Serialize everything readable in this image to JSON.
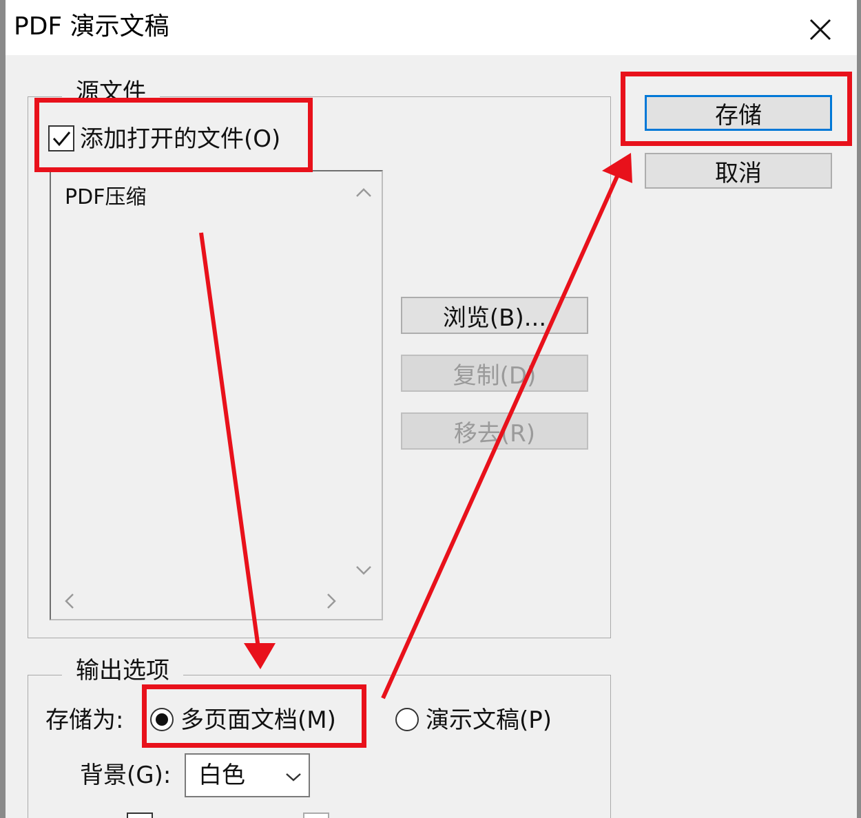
{
  "window": {
    "title": "PDF 演示文稿"
  },
  "source_files": {
    "legend": "源文件",
    "add_open_files_label": "添加打开的文件(O)",
    "add_open_files_checked": true,
    "list_items": [
      "PDF压缩"
    ]
  },
  "file_buttons": {
    "browse": "浏览(B)...",
    "duplicate": "复制(D)",
    "remove": "移去(R)"
  },
  "dialog_buttons": {
    "save": "存储",
    "cancel": "取消"
  },
  "output_options": {
    "legend": "输出选项",
    "save_as_label": "存储为:",
    "option_multipage": "多页面文档(M)",
    "option_presentation": "演示文稿(P)",
    "selected": "多页面文档(M)",
    "background_label": "背景(G):",
    "background_value": "白色"
  },
  "colors": {
    "annotation_red": "#e8111b",
    "default_button_blue": "#0078d7"
  }
}
